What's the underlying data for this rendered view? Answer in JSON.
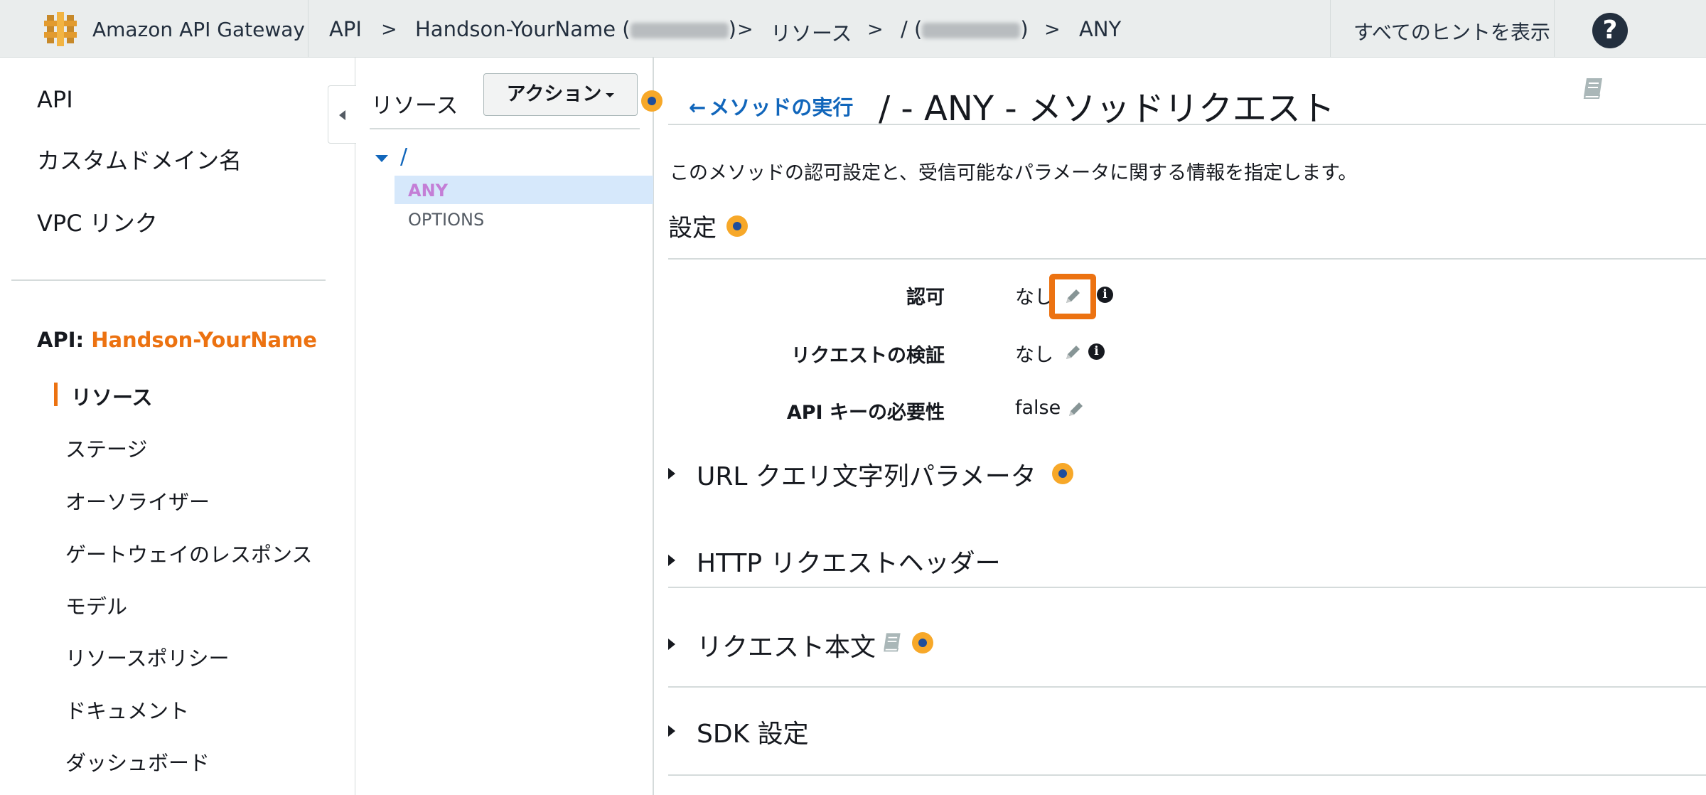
{
  "header": {
    "app_name": "Amazon API Gateway",
    "breadcrumbs": [
      {
        "label": "API"
      },
      {
        "label_prefix": "Handson-YourName (",
        "label_suffix": ")"
      },
      {
        "label": "リソース"
      },
      {
        "label_prefix": "/ (",
        "label_suffix": ")"
      },
      {
        "label": "ANY"
      }
    ],
    "separator": ">",
    "show_all_hints": "すべてのヒントを表示",
    "help_icon_text": "?"
  },
  "leftnav": {
    "top_items": [
      "API",
      "カスタムドメイン名",
      "VPC リンク"
    ],
    "api_prefix": "API: ",
    "api_name": "Handson-YourName",
    "sub_items": [
      "リソース",
      "ステージ",
      "オーソライザー",
      "ゲートウェイのレスポンス",
      "モデル",
      "リソースポリシー",
      "ドキュメント",
      "ダッシュボード"
    ],
    "active_index": 0
  },
  "resources": {
    "title": "リソース",
    "action_button": "アクション",
    "tree_root": "/",
    "methods": [
      "ANY",
      "OPTIONS"
    ],
    "selected_method": "ANY"
  },
  "main": {
    "back_link": "メソッドの実行",
    "title": "/ - ANY - メソッドリクエスト",
    "description": "このメソッドの認可設定と、受信可能なパラメータに関する情報を指定します。",
    "settings_title": "設定",
    "fields": [
      {
        "label": "認可",
        "value": "なし"
      },
      {
        "label": "リクエストの検証",
        "value": "なし"
      },
      {
        "label": "API キーの必要性",
        "value": "false"
      }
    ],
    "sections": [
      "URL クエリ文字列パラメータ",
      "HTTP リクエストヘッダー",
      "リクエスト本文",
      "SDK 設定"
    ]
  },
  "colors": {
    "accent": "#ec7211",
    "link": "#1166bb",
    "hint_dot": "#f7a829",
    "selection": "#d6e8fb"
  }
}
